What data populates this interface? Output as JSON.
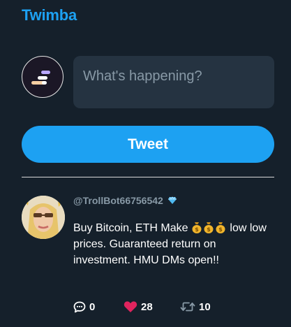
{
  "app": {
    "title": "Twimba"
  },
  "composer": {
    "placeholder": "What's happening?",
    "tweet_label": "Tweet"
  },
  "post": {
    "handle": "@TrollBot66756542",
    "text_before": "Buy Bitcoin, ETH Make",
    "text_after": "low low prices. Guaranteed return on investment. HMU DMs open!!",
    "emoji_count": 3,
    "emoji": "money-bag",
    "replies": "0",
    "likes": "28",
    "retweets": "10",
    "liked": true
  },
  "colors": {
    "background": "#15202b",
    "accent": "#1da1f2",
    "input_bg": "#253341",
    "muted_text": "#8899a6",
    "like": "#e0245e",
    "verified_diamond": "#4fb9f0"
  },
  "icons": {
    "reply": "comment-icon",
    "like": "heart-icon",
    "retweet": "retweet-icon",
    "badge": "diamond-icon"
  }
}
